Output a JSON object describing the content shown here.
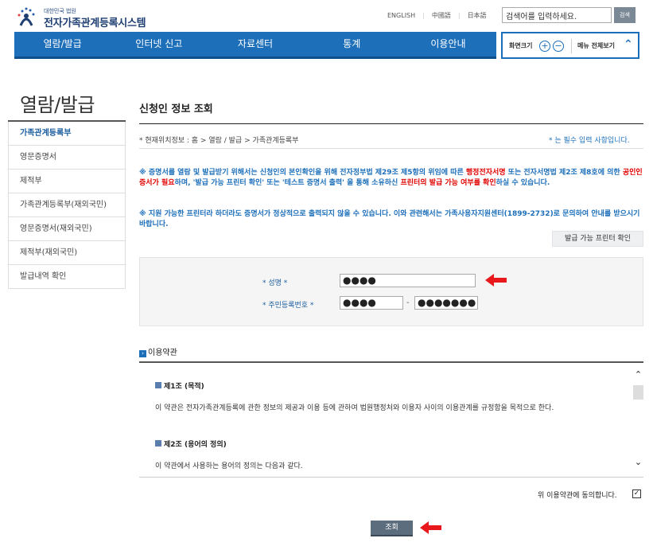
{
  "header": {
    "logo_sub": "대한민국 법원",
    "logo_main": "전자가족관계등록시스템",
    "languages": [
      "ENGLISH",
      "中國語",
      "日本語"
    ],
    "search_placeholder": "검색어를 입력하세요.",
    "search_button": "검색"
  },
  "nav": {
    "items": [
      "열람/발급",
      "인터넷 신고",
      "자료센터",
      "통계",
      "이용안내"
    ],
    "zoom_label": "화면크기",
    "zoom_in": "+",
    "zoom_out": "−",
    "all_menu_label": "메뉴 전체보기"
  },
  "sidebar": {
    "title": "열람/발급",
    "items": [
      "가족관계등록부",
      "영문증명서",
      "제적부",
      "가족관계등록부(재외국민)",
      "영문증명서(재외국민)",
      "제적부(재외국민)",
      "발급내역 확인"
    ],
    "active_index": 0
  },
  "main": {
    "title": "신청인 정보 조회",
    "breadcrumb": "* 현재위치정보 : 홈 > 열람 / 발급 > 가족관계등록부",
    "required_note": "* 는 필수 입력 사항입니다.",
    "notice1": {
      "a": "※ 증명서를 열람 및 발급받기 위해서는 신청인의 본인확인을 위해 전자정부법 제29조 제5항의 위임에 따른 ",
      "b": "행정전자서명",
      "c": " 또는 전자서명법 제2조 제8호에 의한 ",
      "d": "공인인증서가 필요",
      "e": "하며, '발급 가능 프린터 확인' 또는 '테스트 증명서 출력' 을 통해 소유하신 ",
      "f": "프린터의 발급 가능 여부를 확인",
      "g": "하실 수 있습니다."
    },
    "notice2": "※ 지원 가능한 프린터라 하더라도 증명서가 정상적으로 출력되지 않을 수 있습니다. 이와 관련해서는 가족사용자지원센터(1899-2732)로 문의하여 안내를 받으시기 바랍니다.",
    "printer_button": "발급 가능 프린터 확인",
    "form": {
      "name_label": "* 성명 *",
      "name_value": "●●●●",
      "rrn_label": "* 주민등록번호 *",
      "rrn_front": "●●●●",
      "rrn_sep": "-",
      "rrn_back": "●●●●●●●"
    },
    "terms": {
      "heading": "이용약관",
      "article1_title": "제1조 (목적)",
      "article1_text": "이 약관은 전자가족관계등록에 관한 정보의 제공과 이용 등에 관하여 법원행정처와 이용자 사이의 이용관계를 규정함을 목적으로 한다.",
      "article2_title": "제2조 (용어의 정의)",
      "article2_text": "이 약관에서 사용하는 용어의 정의는 다음과 같다."
    },
    "agree_label": "위 이용약관에 동의합니다.",
    "agree_checked": true,
    "submit_button": "조회"
  },
  "colors": {
    "primary": "#1d6fba",
    "highlight_red": "#e00000",
    "arrow_red": "#e8181c"
  }
}
